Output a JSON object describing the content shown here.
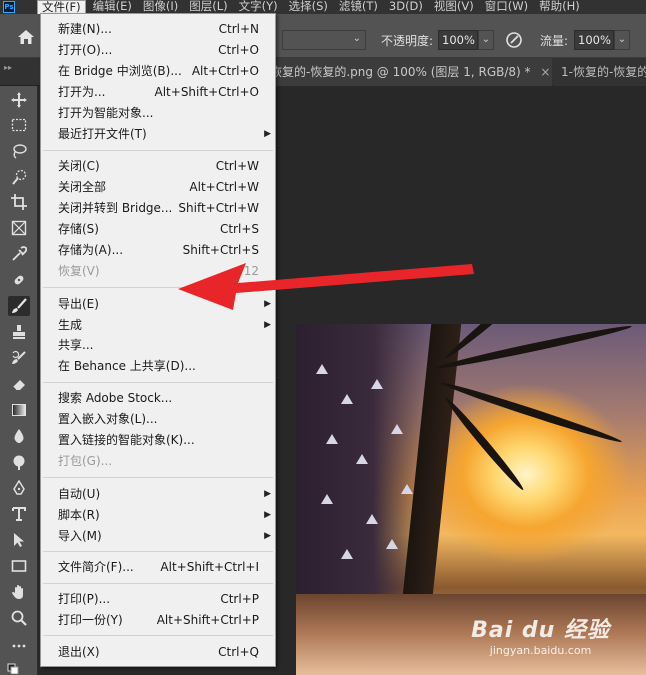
{
  "menubar": {
    "logo": "Ps",
    "items": [
      "文件(F)",
      "编辑(E)",
      "图像(I)",
      "图层(L)",
      "文字(Y)",
      "选择(S)",
      "滤镜(T)",
      "3D(D)",
      "视图(V)",
      "窗口(W)",
      "帮助(H)"
    ],
    "active_index": 0
  },
  "options": {
    "opacity_label": "不透明度:",
    "opacity_value": "100%",
    "flow_label": "流量:",
    "flow_value": "100%"
  },
  "tabs": {
    "tab1": "恢复的-恢复的.png @ 100% (图层 1, RGB/8) *",
    "tab1_close": "×",
    "tab2": "1-恢复的-恢复的"
  },
  "file_menu": {
    "items": [
      {
        "label": "新建(N)...",
        "shortcut": "Ctrl+N"
      },
      {
        "label": "打开(O)...",
        "shortcut": "Ctrl+O"
      },
      {
        "label": "在 Bridge 中浏览(B)...",
        "shortcut": "Alt+Ctrl+O"
      },
      {
        "label": "打开为...",
        "shortcut": "Alt+Shift+Ctrl+O"
      },
      {
        "label": "打开为智能对象...",
        "shortcut": ""
      },
      {
        "label": "最近打开文件(T)",
        "shortcut": "",
        "submenu": true
      },
      {
        "label": "关闭(C)",
        "shortcut": "Ctrl+W"
      },
      {
        "label": "关闭全部",
        "shortcut": "Alt+Ctrl+W"
      },
      {
        "label": "关闭并转到 Bridge...",
        "shortcut": "Shift+Ctrl+W"
      },
      {
        "label": "存储(S)",
        "shortcut": "Ctrl+S"
      },
      {
        "label": "存储为(A)...",
        "shortcut": "Shift+Ctrl+S"
      },
      {
        "label": "恢复(V)",
        "shortcut": "F12",
        "disabled": true
      },
      {
        "label": "导出(E)",
        "shortcut": "",
        "submenu": true
      },
      {
        "label": "生成",
        "shortcut": "",
        "submenu": true
      },
      {
        "label": "共享...",
        "shortcut": ""
      },
      {
        "label": "在 Behance 上共享(D)...",
        "shortcut": ""
      },
      {
        "label": "搜索 Adobe Stock...",
        "shortcut": ""
      },
      {
        "label": "置入嵌入对象(L)...",
        "shortcut": ""
      },
      {
        "label": "置入链接的智能对象(K)...",
        "shortcut": ""
      },
      {
        "label": "打包(G)...",
        "shortcut": "",
        "disabled": true
      },
      {
        "label": "自动(U)",
        "shortcut": "",
        "submenu": true
      },
      {
        "label": "脚本(R)",
        "shortcut": "",
        "submenu": true
      },
      {
        "label": "导入(M)",
        "shortcut": "",
        "submenu": true
      },
      {
        "label": "文件简介(F)...",
        "shortcut": "Alt+Shift+Ctrl+I"
      },
      {
        "label": "打印(P)...",
        "shortcut": "Ctrl+P"
      },
      {
        "label": "打印一份(Y)",
        "shortcut": "Alt+Shift+Ctrl+P"
      },
      {
        "label": "退出(X)",
        "shortcut": "Ctrl+Q"
      }
    ]
  },
  "watermark": {
    "main": "Bai du 经验",
    "sub": "jingyan.baidu.com"
  },
  "colors": {
    "accent": "#31a8ff",
    "arrow": "#e8262a",
    "menu_bg": "#f0f0f0"
  }
}
